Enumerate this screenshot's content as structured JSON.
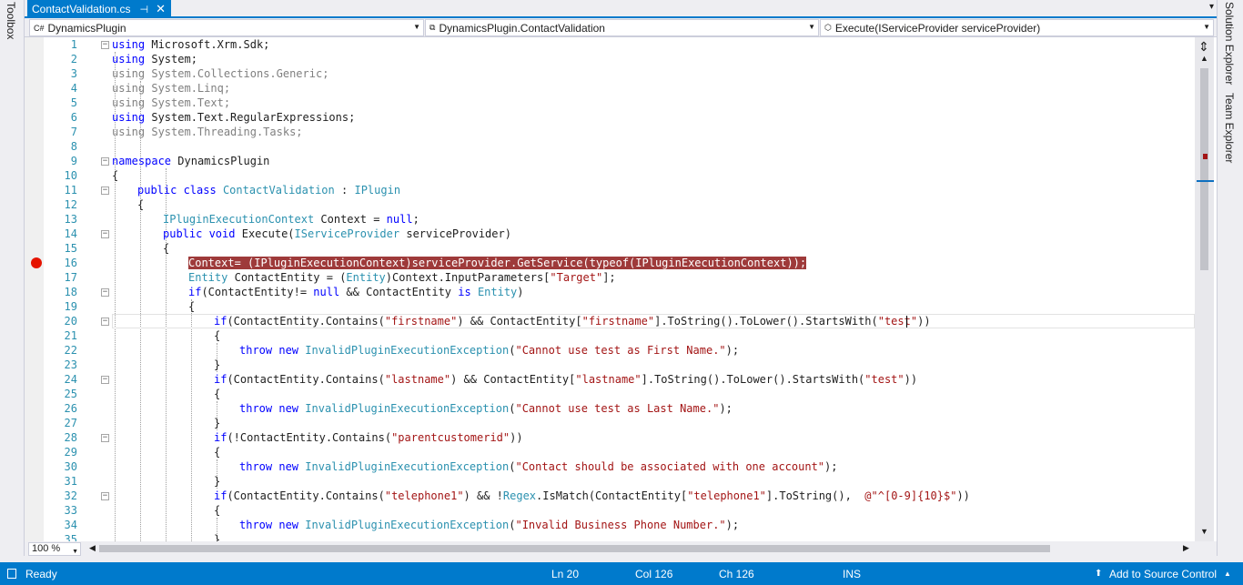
{
  "side_panels": {
    "left_tab": "Toolbox",
    "right_tabs": [
      "Solution Explorer",
      "Team Explorer"
    ]
  },
  "tab": {
    "filename": "ContactValidation.cs",
    "pin_icon": "pin-icon",
    "close_icon": "close-icon"
  },
  "navbar": {
    "project": "DynamicsPlugin",
    "class": "DynamicsPlugin.ContactValidation",
    "member": "Execute(IServiceProvider serviceProvider)"
  },
  "editor": {
    "current_line": 20,
    "breakpoint_line": 16,
    "lines": [
      {
        "n": "1",
        "fold": "minus",
        "indent": 0,
        "parts": [
          [
            "kw",
            "using"
          ],
          [
            "",
            "Microsoft.Xrm.Sdk;"
          ]
        ]
      },
      {
        "n": "2",
        "fold": "",
        "indent": 0,
        "parts": [
          [
            "kw",
            "using"
          ],
          [
            "",
            "System;"
          ]
        ]
      },
      {
        "n": "3",
        "fold": "",
        "indent": 0,
        "parts": [
          [
            "gy",
            "using System.Collections.Generic;"
          ]
        ]
      },
      {
        "n": "4",
        "fold": "",
        "indent": 0,
        "parts": [
          [
            "gy",
            "using System.Linq;"
          ]
        ]
      },
      {
        "n": "5",
        "fold": "",
        "indent": 0,
        "parts": [
          [
            "gy",
            "using System.Text;"
          ]
        ]
      },
      {
        "n": "6",
        "fold": "",
        "indent": 0,
        "parts": [
          [
            "kw",
            "using"
          ],
          [
            "",
            "System.Text.RegularExpressions;"
          ]
        ]
      },
      {
        "n": "7",
        "fold": "",
        "indent": 0,
        "parts": [
          [
            "gy",
            "using System.Threading.Tasks;"
          ]
        ]
      },
      {
        "n": "8",
        "fold": "",
        "indent": 0,
        "parts": []
      },
      {
        "n": "9",
        "fold": "minus",
        "indent": 0,
        "parts": [
          [
            "kw",
            "namespace"
          ],
          [
            "",
            "DynamicsPlugin"
          ]
        ]
      },
      {
        "n": "10",
        "fold": "",
        "indent": 0,
        "parts": [
          [
            "",
            "{"
          ]
        ]
      },
      {
        "n": "11",
        "fold": "minus",
        "indent": 4,
        "parts": [
          [
            "kw",
            "public class"
          ],
          [
            "ty",
            "ContactValidation"
          ],
          [
            "",
            ":"
          ],
          [
            "ty",
            "IPlugin"
          ]
        ]
      },
      {
        "n": "12",
        "fold": "",
        "indent": 4,
        "parts": [
          [
            "",
            "{"
          ]
        ]
      },
      {
        "n": "13",
        "fold": "",
        "indent": 8,
        "parts": [
          [
            "ty",
            "IPluginExecutionContext"
          ],
          [
            "",
            "Context ="
          ],
          [
            "kw",
            "null"
          ],
          [
            "",
            ";"
          ]
        ]
      },
      {
        "n": "14",
        "fold": "minus",
        "indent": 8,
        "parts": [
          [
            "kw",
            "public void"
          ],
          [
            "",
            "Execute("
          ],
          [
            "ty",
            "IServiceProvider"
          ],
          [
            "",
            "serviceProvider)"
          ]
        ]
      },
      {
        "n": "15",
        "fold": "",
        "indent": 8,
        "parts": [
          [
            "",
            "{"
          ]
        ]
      },
      {
        "n": "16",
        "fold": "",
        "indent": 12,
        "parts": [
          [
            "hl",
            "Context= (IPluginExecutionContext)serviceProvider.GetService(typeof(IPluginExecutionContext));"
          ]
        ]
      },
      {
        "n": "17",
        "fold": "",
        "indent": 12,
        "parts": [
          [
            "ty",
            "Entity"
          ],
          [
            "",
            "ContactEntity = ("
          ],
          [
            "ty",
            "Entity"
          ],
          [
            "",
            ")Context.InputParameters["
          ],
          [
            "st",
            "\"Target\""
          ],
          [
            "",
            "];"
          ]
        ]
      },
      {
        "n": "18",
        "fold": "minus",
        "indent": 12,
        "parts": [
          [
            "kw",
            "if"
          ],
          [
            "",
            "(ContactEntity!="
          ],
          [
            "kw",
            "null"
          ],
          [
            "",
            "&& ContactEntity"
          ],
          [
            "kw",
            "is"
          ],
          [
            "ty",
            "Entity"
          ],
          [
            "",
            ")"
          ]
        ]
      },
      {
        "n": "19",
        "fold": "",
        "indent": 12,
        "parts": [
          [
            "",
            "{"
          ]
        ]
      },
      {
        "n": "20",
        "fold": "minus",
        "indent": 16,
        "parts": [
          [
            "kw",
            "if"
          ],
          [
            "",
            "(ContactEntity.Contains("
          ],
          [
            "st",
            "\"firstname\""
          ],
          [
            "",
            ") && ContactEntity["
          ],
          [
            "st",
            "\"firstname\""
          ],
          [
            "",
            "].ToString().ToLower().StartsWith("
          ],
          [
            "st",
            "\"test\""
          ],
          [
            "",
            "))"
          ]
        ]
      },
      {
        "n": "21",
        "fold": "",
        "indent": 16,
        "parts": [
          [
            "",
            "{"
          ]
        ]
      },
      {
        "n": "22",
        "fold": "",
        "indent": 20,
        "parts": [
          [
            "kw",
            "throw new"
          ],
          [
            "ty",
            "InvalidPluginExecutionException"
          ],
          [
            "",
            "("
          ],
          [
            "st",
            "\"Cannot use test as First Name.\""
          ],
          [
            "",
            ");"
          ]
        ]
      },
      {
        "n": "23",
        "fold": "",
        "indent": 16,
        "parts": [
          [
            "",
            "}"
          ]
        ]
      },
      {
        "n": "24",
        "fold": "minus",
        "indent": 16,
        "parts": [
          [
            "kw",
            "if"
          ],
          [
            "",
            "(ContactEntity.Contains("
          ],
          [
            "st",
            "\"lastname\""
          ],
          [
            "",
            ") && ContactEntity["
          ],
          [
            "st",
            "\"lastname\""
          ],
          [
            "",
            "].ToString().ToLower().StartsWith("
          ],
          [
            "st",
            "\"test\""
          ],
          [
            "",
            "))"
          ]
        ]
      },
      {
        "n": "25",
        "fold": "",
        "indent": 16,
        "parts": [
          [
            "",
            "{"
          ]
        ]
      },
      {
        "n": "26",
        "fold": "",
        "indent": 20,
        "parts": [
          [
            "kw",
            "throw new"
          ],
          [
            "ty",
            "InvalidPluginExecutionException"
          ],
          [
            "",
            "("
          ],
          [
            "st",
            "\"Cannot use test as Last Name.\""
          ],
          [
            "",
            ");"
          ]
        ]
      },
      {
        "n": "27",
        "fold": "",
        "indent": 16,
        "parts": [
          [
            "",
            "}"
          ]
        ]
      },
      {
        "n": "28",
        "fold": "minus",
        "indent": 16,
        "parts": [
          [
            "kw",
            "if"
          ],
          [
            "",
            "(!ContactEntity.Contains("
          ],
          [
            "st",
            "\"parentcustomerid\""
          ],
          [
            "",
            "))"
          ]
        ]
      },
      {
        "n": "29",
        "fold": "",
        "indent": 16,
        "parts": [
          [
            "",
            "{"
          ]
        ]
      },
      {
        "n": "30",
        "fold": "",
        "indent": 20,
        "parts": [
          [
            "kw",
            "throw new"
          ],
          [
            "ty",
            "InvalidPluginExecutionException"
          ],
          [
            "",
            "("
          ],
          [
            "st",
            "\"Contact should be associated with one account\""
          ],
          [
            "",
            ");"
          ]
        ]
      },
      {
        "n": "31",
        "fold": "",
        "indent": 16,
        "parts": [
          [
            "",
            "}"
          ]
        ]
      },
      {
        "n": "32",
        "fold": "minus",
        "indent": 16,
        "parts": [
          [
            "kw",
            "if"
          ],
          [
            "",
            "(ContactEntity.Contains("
          ],
          [
            "st",
            "\"telephone1\""
          ],
          [
            "",
            ") && !"
          ],
          [
            "ty",
            "Regex"
          ],
          [
            "",
            ".IsMatch(ContactEntity["
          ],
          [
            "st",
            "\"telephone1\""
          ],
          [
            "",
            "].ToString(), "
          ],
          [
            "st",
            "@\"^[0-9]{10}$\""
          ],
          [
            "",
            "))"
          ]
        ]
      },
      {
        "n": "33",
        "fold": "",
        "indent": 16,
        "parts": [
          [
            "",
            "{"
          ]
        ]
      },
      {
        "n": "34",
        "fold": "",
        "indent": 20,
        "parts": [
          [
            "kw",
            "throw new"
          ],
          [
            "ty",
            "InvalidPluginExecutionException"
          ],
          [
            "",
            "("
          ],
          [
            "st",
            "\"Invalid Business Phone Number.\""
          ],
          [
            "",
            ");"
          ]
        ]
      },
      {
        "n": "35",
        "fold": "",
        "indent": 16,
        "parts": [
          [
            "",
            "}"
          ]
        ]
      }
    ]
  },
  "zoom": "100 %",
  "status": {
    "ready": "Ready",
    "ln": "Ln 20",
    "col": "Col 126",
    "ch": "Ch 126",
    "ins": "INS",
    "source_control": "Add to Source Control"
  },
  "colors": {
    "accent": "#007acc",
    "keyword": "#0000ff",
    "type": "#2b91af",
    "string": "#a31515",
    "breakpoint": "#e51400",
    "breakpoint_highlight": "#9e3a3a"
  }
}
